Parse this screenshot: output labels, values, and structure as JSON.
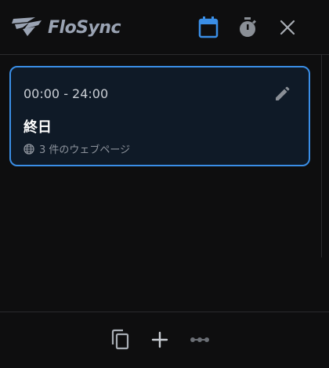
{
  "app": {
    "name": "FloSync"
  },
  "colors": {
    "background": "#0e0e0f",
    "accent": "#3a8ee6",
    "card_background": "#0f1a27",
    "icon_muted": "#8a8f96",
    "logo": "#9aa3b3"
  },
  "header": {
    "icons": [
      "calendar-icon",
      "stopwatch-icon",
      "close-icon"
    ],
    "active_icon": "calendar-icon"
  },
  "schedule": {
    "items": [
      {
        "time_range": "00:00 - 24:00",
        "title": "終日",
        "meta": "3 件のウェブページ",
        "meta_icon": "globe-icon",
        "action_icon": "pencil-icon"
      }
    ]
  },
  "footer": {
    "icons": [
      "copy-icon",
      "plus-icon",
      "more-icon"
    ]
  }
}
